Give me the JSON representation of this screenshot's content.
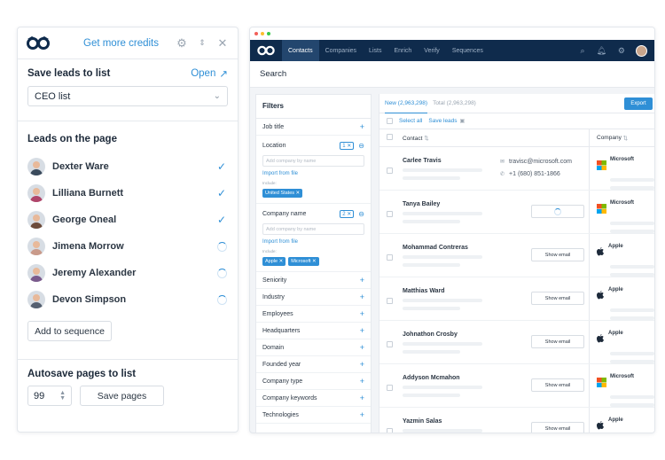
{
  "extension": {
    "credits_link": "Get more credits",
    "save_title": "Save leads to list",
    "open_link": "Open",
    "list_selected": "CEO list",
    "leads_title": "Leads on the page",
    "leads": [
      {
        "name": "Dexter Ware",
        "status": "saved",
        "color": "#3a4a5c"
      },
      {
        "name": "Lilliana Burnett",
        "status": "saved",
        "color": "#b0456a"
      },
      {
        "name": "George Oneal",
        "status": "saved",
        "color": "#6d4b3a"
      },
      {
        "name": "Jimena Morrow",
        "status": "loading",
        "color": "#c99a8a"
      },
      {
        "name": "Jeremy Alexander",
        "status": "loading",
        "color": "#7a5a8c"
      },
      {
        "name": "Devon Simpson",
        "status": "loading",
        "color": "#556070"
      }
    ],
    "add_to_sequence": "Add to sequence",
    "autosave_title": "Autosave pages to list",
    "autosave_value": "99",
    "save_pages": "Save pages"
  },
  "app": {
    "nav_tabs": [
      "Contacts",
      "Companies",
      "Lists",
      "Enrich",
      "Verify",
      "Sequences"
    ],
    "active_tab": "Contacts",
    "search_title": "Search",
    "filters": {
      "title": "Filters",
      "job_title": "Job title",
      "location": {
        "label": "Location",
        "count": "1",
        "placeholder": "Add company by name",
        "import": "Import from file",
        "include": "Include:",
        "chips": [
          "United States"
        ]
      },
      "company_name": {
        "label": "Company name",
        "count": "2",
        "placeholder": "Add company by name",
        "import": "Import from file",
        "include": "Include:",
        "chips": [
          "Apple",
          "Microsoft"
        ]
      },
      "rest": [
        "Seniority",
        "Industry",
        "Employees",
        "Headquarters",
        "Domain",
        "Founded year",
        "Company type",
        "Company keywords",
        "Technologies"
      ]
    },
    "results": {
      "tab_new": "New (2,963,298)",
      "tab_total": "Total (2,963,298)",
      "export": "Export",
      "select_all": "Select all",
      "save_leads": "Save leads",
      "col_contact": "Contact",
      "col_company": "Company",
      "show_email": "Show email",
      "rows": [
        {
          "name": "Carlee Travis",
          "email": "travisc@microsoft.com",
          "phone": "+1 (680) 851-1866",
          "company": "Microsoft",
          "mode": "contact"
        },
        {
          "name": "Tanya Bailey",
          "company": "Microsoft",
          "mode": "loading"
        },
        {
          "name": "Mohammad Contreras",
          "company": "Apple",
          "mode": "button"
        },
        {
          "name": "Matthias Ward",
          "company": "Apple",
          "mode": "button"
        },
        {
          "name": "Johnathon Crosby",
          "company": "Apple",
          "mode": "button"
        },
        {
          "name": "Addyson Mcmahon",
          "company": "Microsoft",
          "mode": "button"
        },
        {
          "name": "Yazmin Salas",
          "company": "Apple",
          "mode": "button"
        }
      ]
    }
  }
}
